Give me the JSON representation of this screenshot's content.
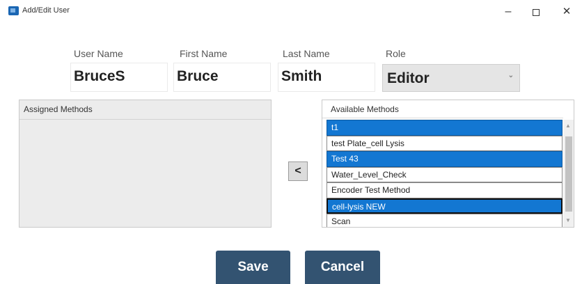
{
  "window": {
    "title": "Add/Edit User",
    "min_glyph": "–",
    "close_glyph": "✕"
  },
  "form": {
    "username_label": "User Name",
    "firstname_label": "First Name",
    "lastname_label": "Last Name",
    "role_label": "Role",
    "username_value": "BruceS",
    "firstname_value": "Bruce",
    "lastname_value": "Smith",
    "role_value": "Editor"
  },
  "assigned": {
    "header": "Assigned Methods",
    "items": []
  },
  "move_button_label": "<",
  "available": {
    "header": "Available Methods",
    "items": [
      {
        "label": "t1",
        "selected": true
      },
      {
        "label": "test Plate_cell Lysis",
        "selected": false
      },
      {
        "label": "Test 43",
        "selected": true
      },
      {
        "label": "Water_Level_Check",
        "selected": false
      },
      {
        "label": "Encoder Test Method",
        "selected": false
      },
      {
        "label": "cell-lysis NEW",
        "selected": true
      },
      {
        "label": "Scan",
        "selected": false
      }
    ]
  },
  "actions": {
    "save_label": "Save",
    "cancel_label": "Cancel"
  },
  "colors": {
    "selection": "#1377d2",
    "button": "#335371"
  }
}
